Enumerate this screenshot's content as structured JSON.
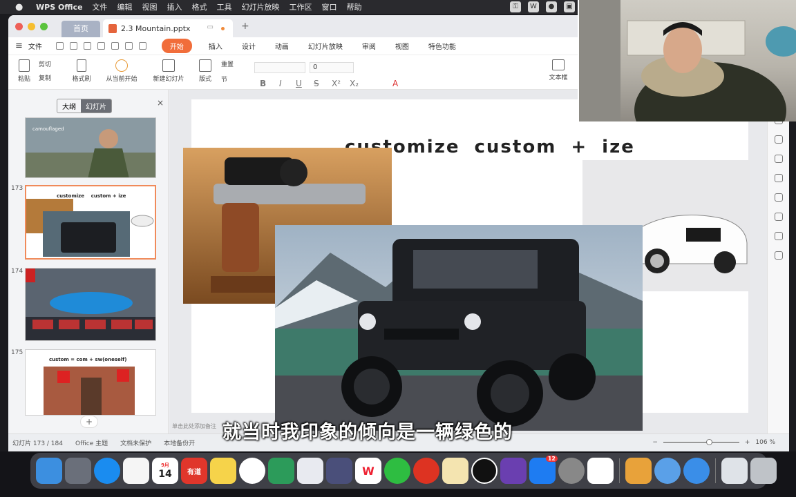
{
  "menubar": {
    "apple": "",
    "app_name": "WPS Office",
    "items": [
      "文件",
      "编辑",
      "视图",
      "插入",
      "格式",
      "工具",
      "幻灯片放映",
      "工作区",
      "窗口",
      "帮助"
    ]
  },
  "window": {
    "home_tab": "首页",
    "doc_tab": "2.3 Mountain.pptx"
  },
  "ribbon": {
    "file_label": "文件",
    "tabs": [
      "开始",
      "插入",
      "设计",
      "动画",
      "幻灯片放映",
      "审阅",
      "视图",
      "特色功能"
    ],
    "active_tab": "开始"
  },
  "toolbar": {
    "paste": "粘贴",
    "cut": "剪切",
    "copy": "复制",
    "format_painter": "格式刷",
    "play_from_current": "从当前开始",
    "new_slide": "新建幻灯片",
    "layout": "版式",
    "section": "节",
    "reset": "重置",
    "font_size": "0",
    "text_box": "文本框"
  },
  "left_panel": {
    "outline_tab": "大纲",
    "slides_tab": "幻灯片",
    "close": "×",
    "add": "+",
    "thumbnails": [
      {
        "number": "",
        "caption": "camouflaged"
      },
      {
        "number": "173",
        "caption": "customize    custom + ize"
      },
      {
        "number": "174",
        "caption": ""
      },
      {
        "number": "175",
        "caption": "custom = com + sw(oneself)"
      }
    ]
  },
  "slide": {
    "title": "customize    custom + ize",
    "notes_placeholder": "单击此处添加备注"
  },
  "status": {
    "slide_counter": "幻灯片 173 / 184",
    "theme": "Office 主题",
    "protect": "文档未保护",
    "backup": "本地备份开",
    "zoom": "106 %"
  },
  "subtitle": "就当时我印象的倾向是一辆绿色的",
  "dock": {
    "calendar_month": "9月",
    "calendar_day": "14",
    "youdao": "有道",
    "wps": "W",
    "app_store_badge": "12"
  },
  "colors": {
    "accent": "#f16d3a",
    "window_bg": "#f3f4f6",
    "dock_bg": "#46484f"
  }
}
